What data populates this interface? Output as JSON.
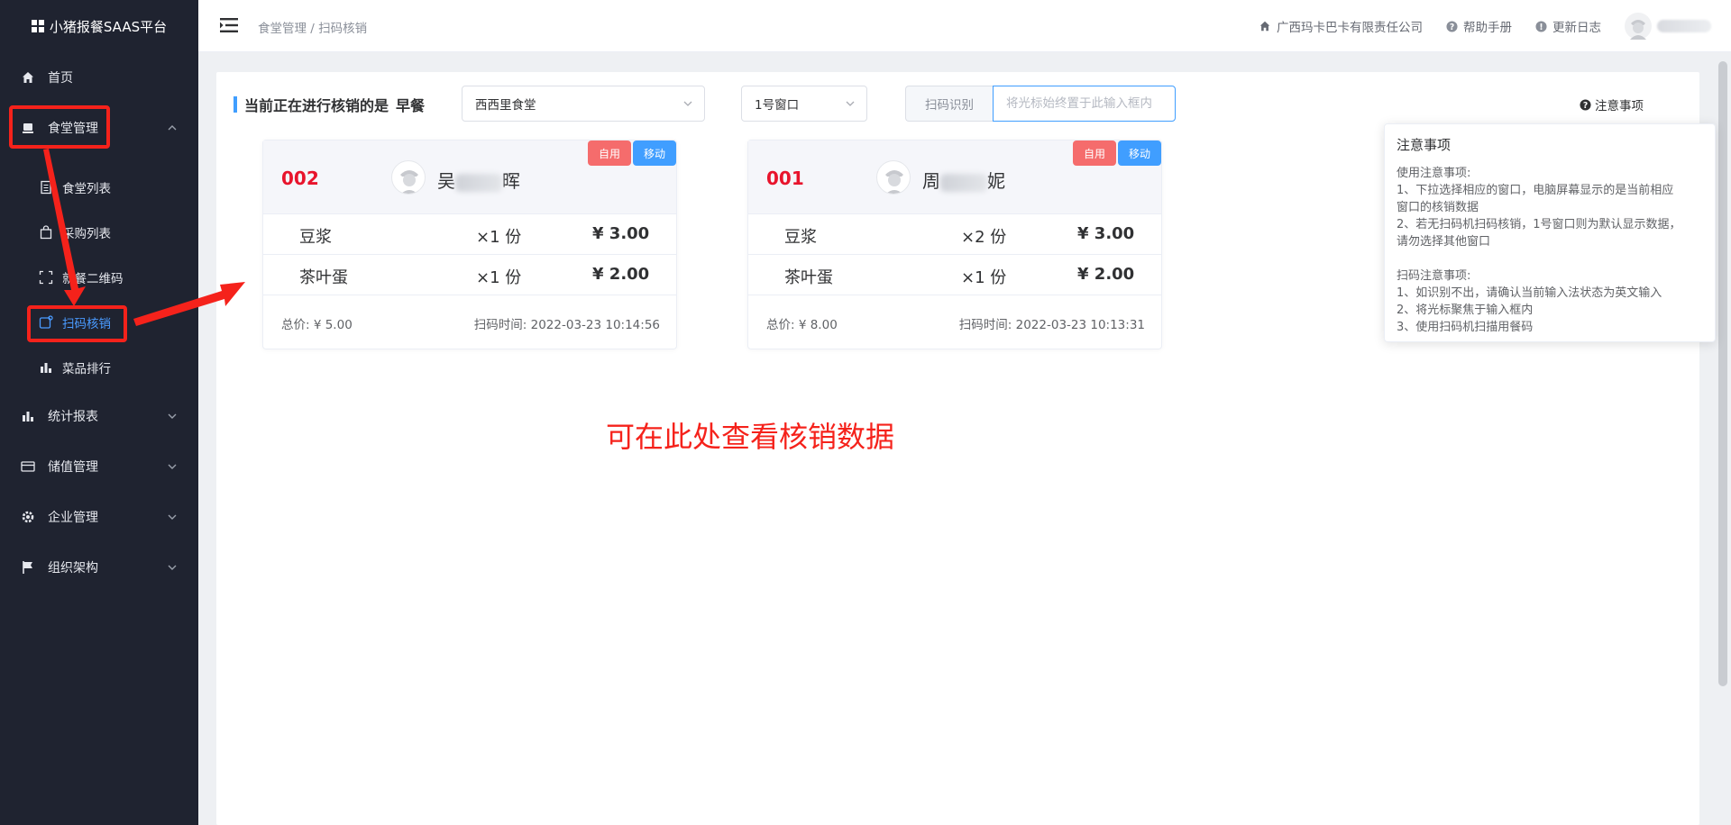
{
  "app": {
    "title": "小猪报餐SAAS平台"
  },
  "sidebar": {
    "items": [
      {
        "label": "首页",
        "icon": "home-icon"
      },
      {
        "label": "食堂管理",
        "icon": "canteen-icon"
      },
      {
        "label": "统计报表",
        "icon": "bar-chart-icon"
      },
      {
        "label": "储值管理",
        "icon": "wallet-icon"
      },
      {
        "label": "企业管理",
        "icon": "gear-icon"
      },
      {
        "label": "组织架构",
        "icon": "flag-icon"
      }
    ],
    "subitems": [
      {
        "label": "食堂列表",
        "icon": "document-icon"
      },
      {
        "label": "采购列表",
        "icon": "shopping-bag-icon"
      },
      {
        "label": "就餐二维码",
        "icon": "scan-frame-icon"
      },
      {
        "label": "扫码核销",
        "icon": "scan-verify-icon"
      },
      {
        "label": "菜品排行",
        "icon": "bar-chart-icon"
      }
    ]
  },
  "header": {
    "breadcrumb": "食堂管理 / 扫码核销",
    "company": "广西玛卡巴卡有限责任公司",
    "help": "帮助手册",
    "changelog": "更新日志"
  },
  "main": {
    "title": "当前正在进行核销的是",
    "meal": "早餐",
    "canteen_select": "西西里食堂",
    "window_select": "1号窗口",
    "scan_label": "扫码识别",
    "scan_placeholder": "将光标始终置于此输入框内",
    "notice_link": "注意事项"
  },
  "notice": {
    "title": "注意事项",
    "usage_title": "使用注意事项:",
    "usage_1": "1、下拉选择相应的窗口，电脑屏幕显示的是当前相应",
    "usage_1b": "窗口的核销数据",
    "usage_2": "2、若无扫码机扫码核销，1号窗口则为默认显示数据，",
    "usage_2b": "请勿选择其他窗口",
    "scan_title": "扫码注意事项:",
    "scan_1": "1、如识别不出，请确认当前输入法状态为英文输入",
    "scan_2": "2、将光标聚焦于输入框内",
    "scan_3": "3、使用扫码机扫描用餐码"
  },
  "cards": [
    {
      "no": "002",
      "name_first": "吴",
      "name_last": "晖",
      "tags": [
        "自用",
        "移动"
      ],
      "items": [
        {
          "name": "豆浆",
          "qty": "×1  份",
          "price": "¥ 3.00"
        },
        {
          "name": "茶叶蛋",
          "qty": "×1  份",
          "price": "¥ 2.00"
        }
      ],
      "total": "总价: ¥ 5.00",
      "scan_time": "扫码时间: 2022-03-23 10:14:56"
    },
    {
      "no": "001",
      "name_first": "周",
      "name_last": "妮",
      "tags": [
        "自用",
        "移动"
      ],
      "items": [
        {
          "name": "豆浆",
          "qty": "×2  份",
          "price": "¥ 3.00"
        },
        {
          "name": "茶叶蛋",
          "qty": "×1  份",
          "price": "¥ 2.00"
        }
      ],
      "total": "总价: ¥ 8.00",
      "scan_time": "扫码时间: 2022-03-23 10:13:31"
    }
  ],
  "annotation": "可在此处查看核销数据",
  "colors": {
    "sidebar_bg": "#1f2330",
    "accent": "#409eff",
    "danger": "#f56c6c",
    "annotation_red": "#f5221b",
    "order_no_red": "#e8142c"
  }
}
